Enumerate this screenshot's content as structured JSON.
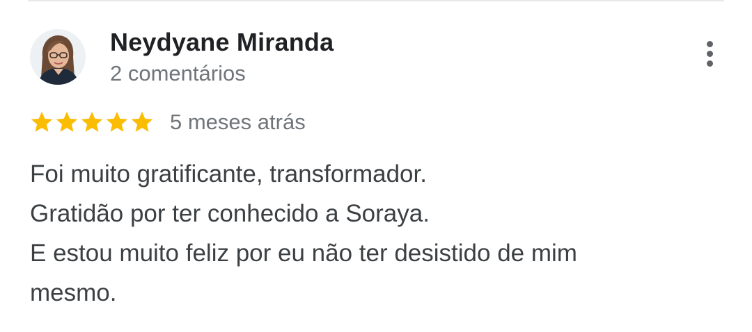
{
  "review": {
    "author_name": "Neydyane Miranda",
    "author_meta": "2 comentários",
    "rating": 5,
    "rating_max": 5,
    "date": "5 meses atrás",
    "text_lines": [
      "Foi muito gratificante, transformador.",
      "Gratidão por ter conhecido a Soraya.",
      "E estou muito feliz por eu não ter desistido de mim",
      "mesmo."
    ],
    "avatar_icon": "user-profile-photo",
    "more_icon": "more-vert-icon",
    "star_icon": "star-icon"
  },
  "colors": {
    "star": "#fbbc04",
    "name": "#202124",
    "meta": "#70757a",
    "body_text": "#3c4043",
    "menu_dots": "#5f6368"
  }
}
